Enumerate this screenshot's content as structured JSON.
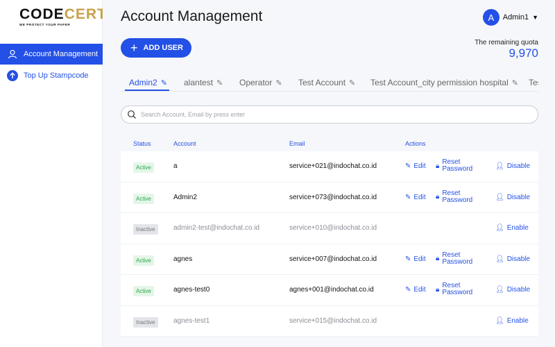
{
  "logo": {
    "main_a": "CODE",
    "main_b": "CERT",
    "tagline": "WE PROTECT YOUR PAPER"
  },
  "sidebar": {
    "items": [
      {
        "label": "Account Management",
        "icon": "user-icon"
      },
      {
        "label": "Top Up Stampcode",
        "icon": "arrow-up-circle-icon"
      }
    ]
  },
  "header": {
    "title": "Account Management",
    "user_initial": "A",
    "user_name": "Admin1",
    "add_user_label": "ADD USER",
    "quota_label": "The remaining quota",
    "quota_value": "9,970"
  },
  "tabs": [
    "Admin2",
    "alantest",
    "Operator",
    "Test Account",
    "Test Account_city permission hospital",
    "Tes"
  ],
  "search": {
    "placeholder": "Search Account, Email by press enter"
  },
  "table": {
    "headers": {
      "status": "Status",
      "account": "Account",
      "email": "Email",
      "actions": "Actions"
    },
    "edit_label": "Edit",
    "reset_label_1": "Reset",
    "reset_label_2": "Password",
    "disable_label": "Disable",
    "enable_label": "Enable",
    "rows": [
      {
        "status": "Active",
        "account": "a",
        "email": "service+021@indochat.co.id"
      },
      {
        "status": "Active",
        "account": "Admin2",
        "email": "service+073@indochat.co.id"
      },
      {
        "status": "Inactive",
        "account": "admin2-test@indochat.co.id",
        "email": "service+010@indochat.co.id"
      },
      {
        "status": "Active",
        "account": "agnes",
        "email": "service+007@indochat.co.id"
      },
      {
        "status": "Active",
        "account": "agnes-test0",
        "email": "agnes+001@indochat.co.id"
      },
      {
        "status": "Inactive",
        "account": "agnes-test1",
        "email": "service+015@indochat.co.id"
      }
    ]
  },
  "colors": {
    "accent": "#2350e6",
    "active_badge": "#2ea44f",
    "gold": "#c8a24a"
  }
}
